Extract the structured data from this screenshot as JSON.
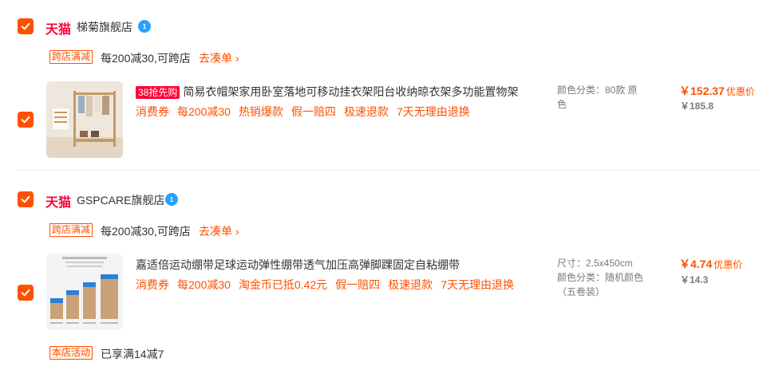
{
  "shops": [
    {
      "platform": "天猫",
      "name": "梯菊旗舰店",
      "promo": {
        "tag": "跨店满减",
        "text": "每200减30,可跨店",
        "link": "去凑单 ›"
      },
      "item": {
        "hot_tag": "38抢先购",
        "title": "简易衣帽架家用卧室落地可移动挂衣架阳台收纳晾衣架多功能置物架",
        "services": [
          "消费券",
          "每200减30",
          "热销爆款",
          "假一赔四",
          "极速退款",
          "7天无理由退换"
        ],
        "sku": [
          "颜色分类：80款 原",
          "色"
        ],
        "price": "￥152.37",
        "price_note": "优惠价",
        "old_price": "￥185.8"
      }
    },
    {
      "platform": "天猫",
      "name": "GSPCARE旗舰店",
      "promo": {
        "tag": "跨店满减",
        "text": "每200减30,可跨店",
        "link": "去凑单 ›"
      },
      "item": {
        "title": "嘉适倍运动绷带足球运动弹性绷带透气加压高弹脚踝固定自粘绷带",
        "services": [
          "消费券",
          "每200减30",
          "淘金币已抵0.42元",
          "假一赔四",
          "极速退款",
          "7天无理由退换"
        ],
        "sku": [
          "尺寸：2.5x450cm",
          "颜色分类：随机颜色",
          "（五卷装）"
        ],
        "price": "￥4.74",
        "price_note": "优惠价",
        "old_price": "￥14.3"
      },
      "shop_activity": {
        "tag": "本店活动",
        "text": "已享满14减7"
      }
    }
  ],
  "colors": {
    "accent": "#ff5000",
    "tmall": "#ff0036",
    "verified": "#2aa1ff"
  },
  "icons": {
    "checkbox": "checkmark-icon",
    "verified": "verified-badge-icon"
  }
}
